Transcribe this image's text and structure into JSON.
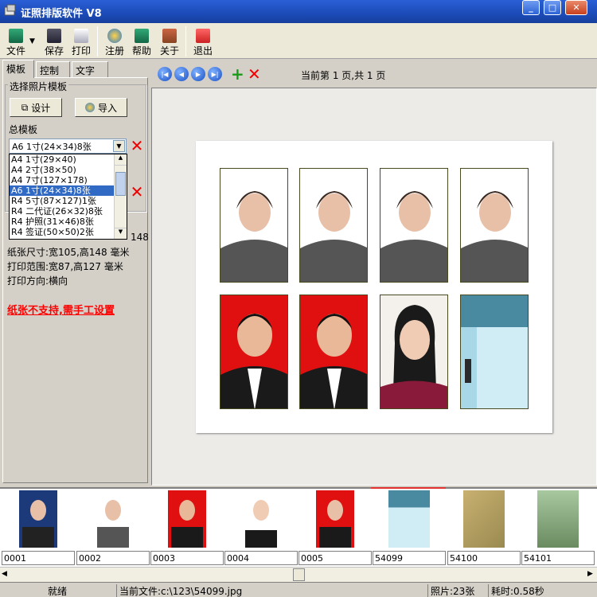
{
  "window": {
    "title": "证照排版软件 V8"
  },
  "toolbar": {
    "file": "文件",
    "save": "保存",
    "print": "打印",
    "register": "注册",
    "help": "帮助",
    "about": "关于",
    "exit": "退出"
  },
  "tabs": [
    "模板",
    "控制",
    "文字"
  ],
  "template_group": {
    "title": "选择照片模板",
    "design_button": "设计",
    "import_button": "导入"
  },
  "main_template": {
    "label": "总模板",
    "selected": "A6 1寸(24×34)8张",
    "options": [
      "A4 1寸(29×40)",
      "A4 2寸(38×50)",
      "A4 7寸(127×178)",
      "A6 1寸(24×34)8张",
      "R4 5寸(87×127)1张",
      "R4 二代证(26×32)8张",
      "R4 护照(31×46)8张",
      "R4 签证(50×50)2张"
    ]
  },
  "info": {
    "partial_text": "148",
    "paper_size": "纸张尺寸:宽105,高148 毫米",
    "print_range": "打印范围:宽87,高127 毫米",
    "print_direction": "打印方向:横向",
    "warning": "纸张不支持,需手工设置"
  },
  "nav": {
    "page_info": "当前第 1 页,共 1 页"
  },
  "thumbnails": [
    {
      "label": "0001",
      "bg": "#1c3a7a"
    },
    {
      "label": "0002",
      "bg": "#ffffff"
    },
    {
      "label": "0003",
      "bg": "#e01010"
    },
    {
      "label": "0004",
      "bg": "#ffffff"
    },
    {
      "label": "0005",
      "bg": "#e01010"
    },
    {
      "label": "54099",
      "bg": "#a8d8e8"
    },
    {
      "label": "54100",
      "bg": "#c8b070"
    },
    {
      "label": "54101",
      "bg": "#a8c8a0"
    }
  ],
  "status": {
    "ready": "就绪",
    "current_file": "当前文件:c:\\123\\54099.jpg",
    "photo_count": "照片:23张",
    "elapsed": "耗时:0.58秒"
  },
  "colors": {
    "title_bar": "#1c4bb8",
    "warning": "#ff0000",
    "selection": "#316ac5"
  }
}
